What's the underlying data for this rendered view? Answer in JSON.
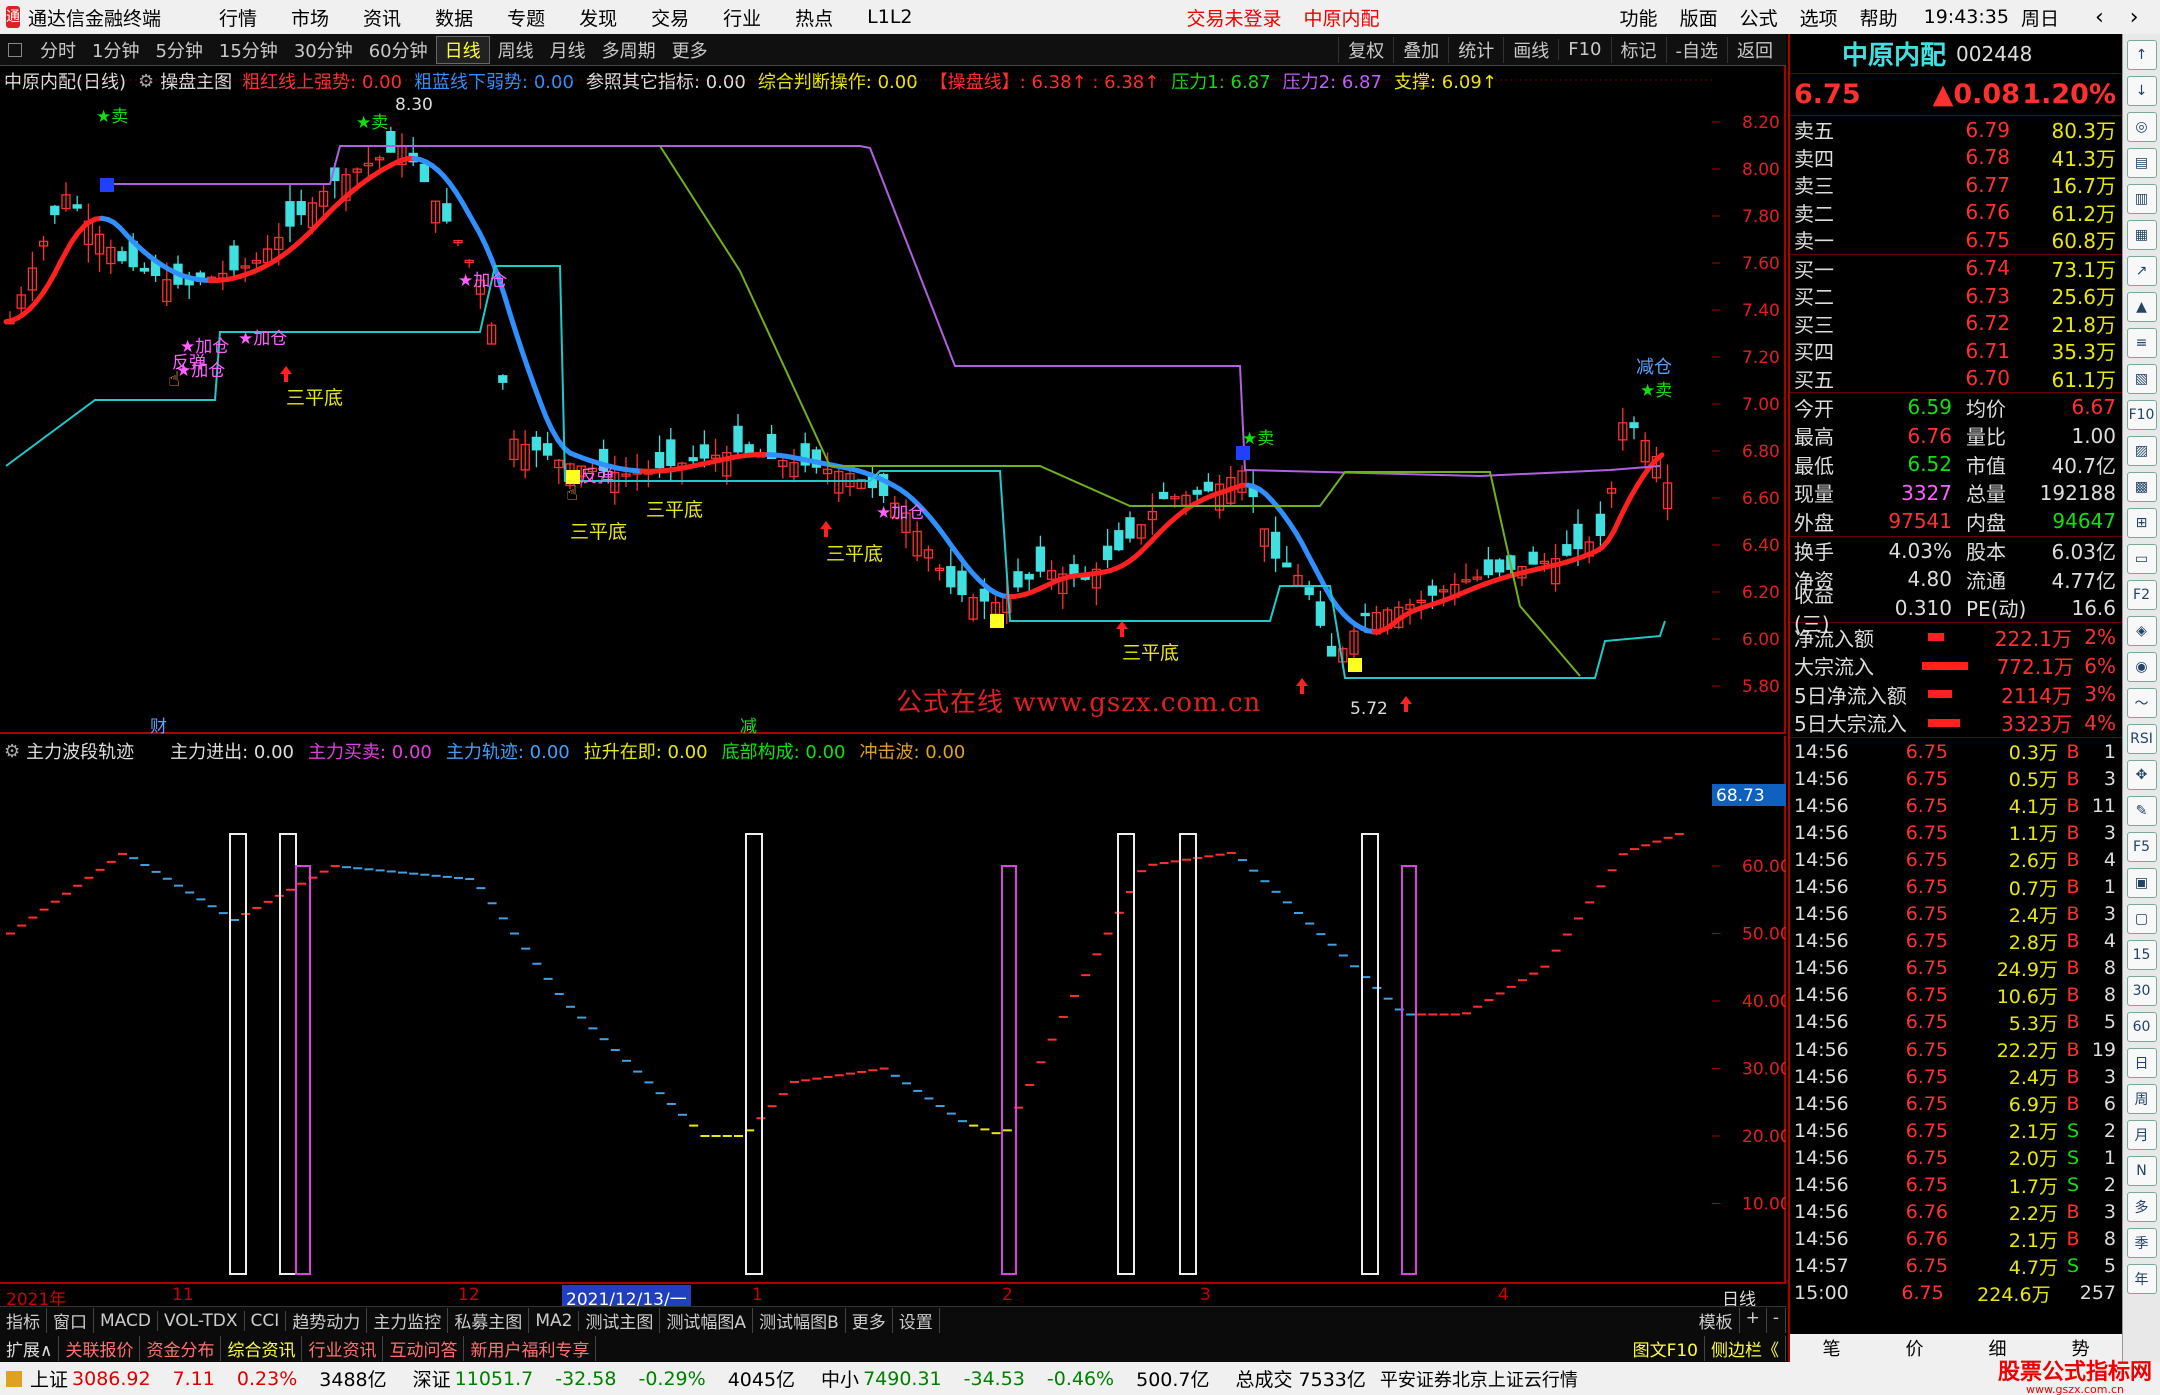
{
  "app": {
    "title": "通达信金融终端",
    "menus": [
      "行情",
      "市场",
      "资讯",
      "数据",
      "专题",
      "发现",
      "交易",
      "行业",
      "热点",
      "L1L2"
    ],
    "login_status": "交易未登录",
    "stock_name": "中原内配",
    "right_menus": [
      "功能",
      "版面",
      "公式",
      "选项",
      "帮助"
    ],
    "clock": "19:43:35",
    "weekday": "周日"
  },
  "periods": [
    "分时",
    "1分钟",
    "5分钟",
    "15分钟",
    "30分钟",
    "60分钟",
    "日线",
    "周线",
    "月线",
    "多周期",
    "更多"
  ],
  "active_period": "日线",
  "toolbar": [
    "复权",
    "叠加",
    "统计",
    "画线",
    "F10",
    "标记",
    "-自选",
    "返回"
  ],
  "main_info": {
    "name": "中原内配(日线)",
    "formula": "操盘主图",
    "items": [
      {
        "text": "粗红线上强势: 0.00",
        "color": "#ff3030"
      },
      {
        "text": "粗蓝线下弱势: 0.00",
        "color": "#3090ff"
      },
      {
        "text": "参照其它指标: 0.00",
        "color": "#dddddd"
      },
      {
        "text": "综合判断操作: 0.00",
        "color": "#e8e80a"
      },
      {
        "text": "【操盘线】: 6.38↑ : 6.38↑",
        "color": "#ff3030"
      },
      {
        "text": "压力1: 6.87",
        "color": "#10e010"
      },
      {
        "text": "压力2: 6.87",
        "color": "#c060ff"
      },
      {
        "text": "支撑: 6.09↑",
        "color": "#e8e80a"
      }
    ]
  },
  "price_axis": [
    "8.20",
    "8.00",
    "7.80",
    "7.60",
    "7.40",
    "7.20",
    "7.00",
    "6.80",
    "6.60",
    "6.40",
    "6.20",
    "6.00",
    "5.80"
  ],
  "annotations": {
    "high_label": "8.30",
    "low_label": "5.72",
    "sell": "★卖",
    "add": "★加仓",
    "rebound": "反弹",
    "triple_bottom": "三平底",
    "reduce": "减仓",
    "cai": "财",
    "jian": "减"
  },
  "watermark": "公式在线 www.gszx.com.cn",
  "sub_info": {
    "formula": "主力波段轨迹",
    "items": [
      {
        "text": "主力进出: 0.00",
        "color": "#dddddd"
      },
      {
        "text": "主力买卖: 0.00",
        "color": "#e040e0"
      },
      {
        "text": "主力轨迹: 0.00",
        "color": "#40a0ff"
      },
      {
        "text": "拉升在即: 0.00",
        "color": "#e8e80a"
      },
      {
        "text": "底部构成: 0.00",
        "color": "#10e010"
      },
      {
        "text": "冲击波: 0.00",
        "color": "#e0a020"
      }
    ]
  },
  "sub_axis": [
    "60.00",
    "50.00",
    "40.00",
    "30.00",
    "20.00",
    "10.00"
  ],
  "sub_value": "68.73",
  "time_axis": [
    "2021年",
    "11",
    "12",
    "2021/12/13/一",
    "1",
    "2",
    "3",
    "4"
  ],
  "time_axis_right": "日线",
  "tabs1": [
    "指标",
    "窗口",
    "MACD",
    "VOL-TDX",
    "CCI",
    "趋势动力",
    "主力监控",
    "私募主图",
    "MA2",
    "测试主图",
    "测试幅图A",
    "测试幅图B",
    "更多",
    "设置"
  ],
  "tabs1_right": [
    "模板",
    "+",
    "-"
  ],
  "tabs2": [
    "扩展∧",
    "关联报价",
    "资金分布",
    "综合资讯",
    "行业资讯",
    "互动问答",
    "新用户福利专享"
  ],
  "tabs2_right": [
    "图文F10",
    "侧边栏《"
  ],
  "quote": {
    "name": "中原内配",
    "code": "002448",
    "price": "6.75",
    "change": "▲0.08",
    "pct": "1.20%",
    "asks": [
      {
        "label": "卖五",
        "price": "6.79",
        "vol": "80.3万"
      },
      {
        "label": "卖四",
        "price": "6.78",
        "vol": "41.3万"
      },
      {
        "label": "卖三",
        "price": "6.77",
        "vol": "16.7万"
      },
      {
        "label": "卖二",
        "price": "6.76",
        "vol": "61.2万"
      },
      {
        "label": "卖一",
        "price": "6.75",
        "vol": "60.8万"
      }
    ],
    "bids": [
      {
        "label": "买一",
        "price": "6.74",
        "vol": "73.1万"
      },
      {
        "label": "买二",
        "price": "6.73",
        "vol": "25.6万"
      },
      {
        "label": "买三",
        "price": "6.72",
        "vol": "21.8万"
      },
      {
        "label": "买四",
        "price": "6.71",
        "vol": "35.3万"
      },
      {
        "label": "买五",
        "price": "6.70",
        "vol": "61.1万"
      }
    ],
    "stats1": [
      [
        "今开",
        "6.59",
        "均价",
        "6.67"
      ],
      [
        "最高",
        "6.76",
        "量比",
        "1.00"
      ],
      [
        "最低",
        "6.52",
        "市值",
        "40.7亿"
      ],
      [
        "现量",
        "3327",
        "总量",
        "192188"
      ],
      [
        "外盘",
        "97541",
        "内盘",
        "94647"
      ]
    ],
    "stats2": [
      [
        "换手",
        "4.03%",
        "股本",
        "6.03亿"
      ],
      [
        "净资",
        "4.80",
        "流通",
        "4.77亿"
      ],
      [
        "收益(三)",
        "0.310",
        "PE(动)",
        "16.6"
      ]
    ],
    "flows": [
      {
        "label": "净流入额",
        "val": "222.1万",
        "pct": "2%"
      },
      {
        "label": "大宗流入",
        "val": "772.1万",
        "pct": "6%"
      },
      {
        "label": "5日净流入额",
        "val": "2114万",
        "pct": "3%"
      },
      {
        "label": "5日大宗流入",
        "val": "3323万",
        "pct": "4%"
      }
    ],
    "ticks": [
      [
        "14:56",
        "6.75",
        "0.3万",
        "B",
        "1"
      ],
      [
        "14:56",
        "6.75",
        "0.5万",
        "B",
        "3"
      ],
      [
        "14:56",
        "6.75",
        "4.1万",
        "B",
        "11"
      ],
      [
        "14:56",
        "6.75",
        "1.1万",
        "B",
        "3"
      ],
      [
        "14:56",
        "6.75",
        "2.6万",
        "B",
        "4"
      ],
      [
        "14:56",
        "6.75",
        "0.7万",
        "B",
        "1"
      ],
      [
        "14:56",
        "6.75",
        "2.4万",
        "B",
        "3"
      ],
      [
        "14:56",
        "6.75",
        "2.8万",
        "B",
        "4"
      ],
      [
        "14:56",
        "6.75",
        "24.9万",
        "B",
        "8"
      ],
      [
        "14:56",
        "6.75",
        "10.6万",
        "B",
        "8"
      ],
      [
        "14:56",
        "6.75",
        "5.3万",
        "B",
        "5"
      ],
      [
        "14:56",
        "6.75",
        "22.2万",
        "B",
        "19"
      ],
      [
        "14:56",
        "6.75",
        "2.4万",
        "B",
        "3"
      ],
      [
        "14:56",
        "6.75",
        "6.9万",
        "B",
        "6"
      ],
      [
        "14:56",
        "6.75",
        "2.1万",
        "S",
        "2"
      ],
      [
        "14:56",
        "6.75",
        "2.0万",
        "S",
        "1"
      ],
      [
        "14:56",
        "6.75",
        "1.7万",
        "S",
        "2"
      ],
      [
        "14:56",
        "6.76",
        "2.2万",
        "B",
        "3"
      ],
      [
        "14:56",
        "6.76",
        "2.1万",
        "B",
        "8"
      ],
      [
        "14:57",
        "6.75",
        "4.7万",
        "S",
        "5"
      ],
      [
        "15:00",
        "6.75",
        "224.6万",
        "",
        ""
      ]
    ],
    "tick_last_num": "257",
    "bottom_tabs": [
      "笔",
      "价",
      "细",
      "势"
    ]
  },
  "sidetool_labels": [
    "↑",
    "↓",
    "◎",
    "▤",
    "▥",
    "▦",
    "↗",
    "▲",
    "≡",
    "▧",
    "F10",
    "▨",
    "▩",
    "⊞",
    "▭",
    "F2",
    "◈",
    "◉",
    "〜",
    "RSI",
    "✥",
    "✎",
    "F5",
    "▣",
    "▢",
    "15",
    "30",
    "60",
    "日",
    "周",
    "月",
    "N",
    "多",
    "季",
    "年"
  ],
  "index_bar": [
    {
      "name": "上证",
      "val": "3086.92",
      "chg": "7.11",
      "pct": "0.23%",
      "amt": "3488亿"
    },
    {
      "name": "深证",
      "val": "11051.7",
      "chg": "-32.58",
      "pct": "-0.29%",
      "amt": "4045亿"
    },
    {
      "name": "中小",
      "val": "7490.31",
      "chg": "-34.53",
      "pct": "-0.46%",
      "amt": "500.7亿"
    }
  ],
  "total_label": "总成交",
  "total_val": "7533亿",
  "broker": "平安证券北京上证云行情",
  "logo_text": "股票公式指标网",
  "logo_url": "www.gszx.com.cn",
  "colors": {
    "up": "#ff3030",
    "down": "#40e0e0",
    "ma_red": "#ff2020",
    "ma_blue": "#3090ff",
    "axis": "#aa0000"
  }
}
